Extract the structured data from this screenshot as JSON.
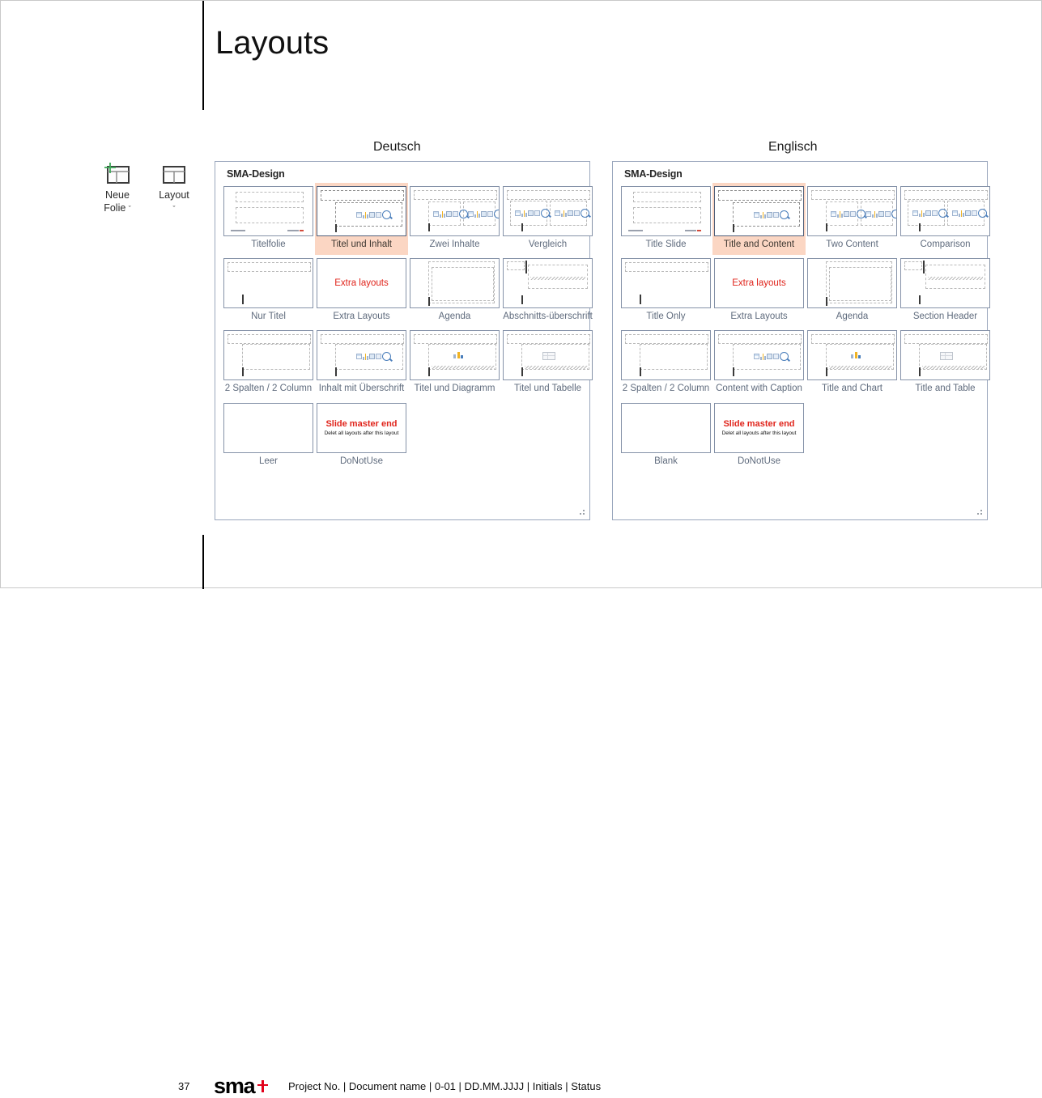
{
  "slide": {
    "title": "Layouts",
    "slide_number": "37",
    "footer_text": "Project No. | Document name | 0-01 | DD.MM.JJJJ | Initials | Status",
    "logo_text": "sma",
    "logo_mark": "red-cross-mark"
  },
  "ribbon": {
    "buttons": [
      {
        "label_line1": "Neue",
        "label_line2": "Folie",
        "caret": "ˇ",
        "icon": "new-slide-icon"
      },
      {
        "label_line1": "Layout",
        "label_line2": "",
        "caret": "ˇ",
        "icon": "layout-icon"
      }
    ]
  },
  "columns": {
    "german_heading": "Deutsch",
    "english_heading": "Englisch"
  },
  "panels": [
    {
      "id": "german",
      "title": "SMA-Design",
      "items": [
        {
          "caption": "Titelfolie",
          "kind": "title-slide",
          "selected": false
        },
        {
          "caption": "Titel und Inhalt",
          "kind": "title-content",
          "selected": true
        },
        {
          "caption": "Zwei Inhalte",
          "kind": "two-content",
          "selected": false
        },
        {
          "caption": "Vergleich",
          "kind": "comparison",
          "selected": false
        },
        {
          "caption": "Nur Titel",
          "kind": "title-only",
          "selected": false
        },
        {
          "caption": "Extra Layouts",
          "kind": "extra-layouts",
          "selected": false,
          "inner_text": "Extra layouts"
        },
        {
          "caption": "Agenda",
          "kind": "agenda",
          "selected": false
        },
        {
          "caption": "Abschnitts-überschrift",
          "kind": "section-header",
          "selected": false
        },
        {
          "caption": "2 Spalten / 2 Column",
          "kind": "two-column",
          "selected": false
        },
        {
          "caption": "Inhalt mit Überschrift",
          "kind": "content-caption",
          "selected": false
        },
        {
          "caption": "Titel und Diagramm",
          "kind": "title-chart",
          "selected": false
        },
        {
          "caption": "Titel und Tabelle",
          "kind": "title-table",
          "selected": false
        },
        {
          "caption": "Leer",
          "kind": "blank",
          "selected": false
        },
        {
          "caption": "DoNotUse",
          "kind": "donotuse",
          "selected": false,
          "inner_title": "Slide master end",
          "inner_sub": "Delet all layouts after this layout"
        },
        {
          "caption": "",
          "kind": "empty",
          "selected": false
        },
        {
          "caption": "",
          "kind": "empty",
          "selected": false
        }
      ]
    },
    {
      "id": "english",
      "title": "SMA-Design",
      "items": [
        {
          "caption": "Title Slide",
          "kind": "title-slide",
          "selected": false
        },
        {
          "caption": "Title and Content",
          "kind": "title-content",
          "selected": true
        },
        {
          "caption": "Two Content",
          "kind": "two-content",
          "selected": false
        },
        {
          "caption": "Comparison",
          "kind": "comparison",
          "selected": false
        },
        {
          "caption": "Title Only",
          "kind": "title-only",
          "selected": false
        },
        {
          "caption": "Extra Layouts",
          "kind": "extra-layouts",
          "selected": false,
          "inner_text": "Extra layouts"
        },
        {
          "caption": "Agenda",
          "kind": "agenda",
          "selected": false
        },
        {
          "caption": "Section Header",
          "kind": "section-header",
          "selected": false
        },
        {
          "caption": "2 Spalten / 2 Column",
          "kind": "two-column",
          "selected": false
        },
        {
          "caption": "Content with Caption",
          "kind": "content-caption",
          "selected": false
        },
        {
          "caption": "Title and Chart",
          "kind": "title-chart",
          "selected": false
        },
        {
          "caption": "Title and Table",
          "kind": "title-table",
          "selected": false
        },
        {
          "caption": "Blank",
          "kind": "blank",
          "selected": false
        },
        {
          "caption": "DoNotUse",
          "kind": "donotuse",
          "selected": false,
          "inner_title": "Slide master end",
          "inner_sub": "Delet all layouts after this layout"
        },
        {
          "caption": "",
          "kind": "empty",
          "selected": false
        },
        {
          "caption": "",
          "kind": "empty",
          "selected": false
        }
      ]
    }
  ],
  "colors": {
    "selection_fill": "#fbd6c3",
    "panel_border": "#9aa7bd",
    "caption_text": "#5f6b7d",
    "accent_red": "#e0241b",
    "logo_red": "#e2001a"
  }
}
